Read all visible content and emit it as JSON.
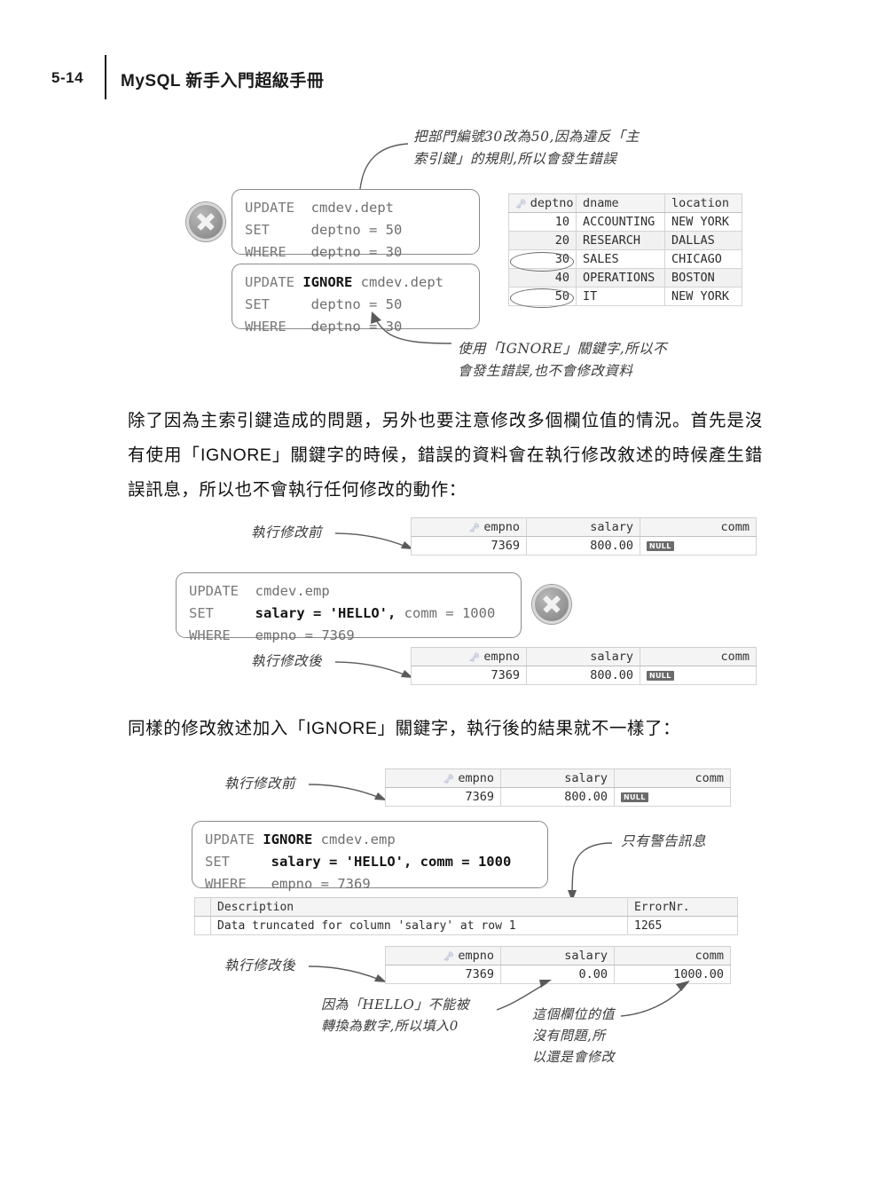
{
  "header": {
    "folio": "5-14",
    "book_title": "MySQL 新手入門超級手冊"
  },
  "section_dept": {
    "annotation_top": "把部門編號30改為50,因為違反「主\n索引鍵」的規則,所以會發生錯誤",
    "annotation_bottom": "使用「IGNORE」關鍵字,所以不\n會發生錯誤,也不會修改資料",
    "sql_fail": {
      "line1_kw": "UPDATE",
      "line1_rest": "  cmdev.dept",
      "line2_kw": "SET",
      "line2_rest": "     deptno = 50",
      "line3_kw": "WHERE",
      "line3_rest": "   deptno = 30"
    },
    "sql_ignore": {
      "line1_kw": "UPDATE",
      "line1_bold": "IGNORE",
      "line1_rest": " cmdev.dept",
      "line2_kw": "SET",
      "line2_rest": "     deptno = 50",
      "line3_kw": "WHERE",
      "line3_rest": "   deptno = 30"
    },
    "table": {
      "columns": [
        "deptno",
        "dname",
        "location"
      ],
      "rows": [
        {
          "deptno": "10",
          "dname": "ACCOUNTING",
          "location": "NEW YORK",
          "circled": false
        },
        {
          "deptno": "20",
          "dname": "RESEARCH",
          "location": "DALLAS",
          "circled": false
        },
        {
          "deptno": "30",
          "dname": "SALES",
          "location": "CHICAGO",
          "circled": true
        },
        {
          "deptno": "40",
          "dname": "OPERATIONS",
          "location": "BOSTON",
          "circled": false
        },
        {
          "deptno": "50",
          "dname": "IT",
          "location": "NEW YORK",
          "circled": true
        }
      ]
    }
  },
  "paragraph_1": "除了因為主索引鍵造成的問題，另外也要注意修改多個欄位值的情況。首先是沒有使用「IGNORE」關鍵字的時候，錯誤的資料會在執行修改敘述的時候產生錯誤訊息，所以也不會執行任何修改的動作：",
  "section_noignore": {
    "label_before": "執行修改前",
    "label_after": "執行修改後",
    "sql": {
      "line1_kw": "UPDATE",
      "line1_rest": "  cmdev.emp",
      "line2_kw": "SET",
      "line2_bold": "salary = 'HELLO',",
      "line2_rest": " comm = 1000",
      "line3_kw": "WHERE",
      "line3_rest": "   empno = 7369"
    },
    "table_columns": [
      "empno",
      "salary",
      "comm"
    ],
    "table_before": {
      "empno": "7369",
      "salary": "800.00",
      "comm": "NULL"
    },
    "table_after": {
      "empno": "7369",
      "salary": "800.00",
      "comm": "NULL"
    }
  },
  "paragraph_2": "同樣的修改敘述加入「IGNORE」關鍵字，執行後的結果就不一樣了：",
  "section_ignore": {
    "label_before": "執行修改前",
    "label_after": "執行修改後",
    "annotation_warning": "只有警告訊息",
    "annotation_hello": "因為「HELLO」不能被\n轉換為數字,所以填入0",
    "annotation_comm": "這個欄位的值\n沒有問題,所\n以還是會修改",
    "sql": {
      "line1_kw": "UPDATE",
      "line1_bold": "IGNORE",
      "line1_rest": " cmdev.emp",
      "line2_kw": "SET",
      "line2_bold": "salary = 'HELLO', comm = 1000",
      "line3_kw": "WHERE",
      "line3_rest": "   empno = 7369"
    },
    "table_columns": [
      "empno",
      "salary",
      "comm"
    ],
    "table_before": {
      "empno": "7369",
      "salary": "800.00",
      "comm": "NULL"
    },
    "table_after": {
      "empno": "7369",
      "salary": "0.00",
      "comm": "1000.00"
    },
    "warning_table": {
      "columns": [
        "Description",
        "ErrorNr."
      ],
      "row": {
        "description": "Data truncated for column 'salary' at row 1",
        "errornr": "1265"
      }
    }
  }
}
